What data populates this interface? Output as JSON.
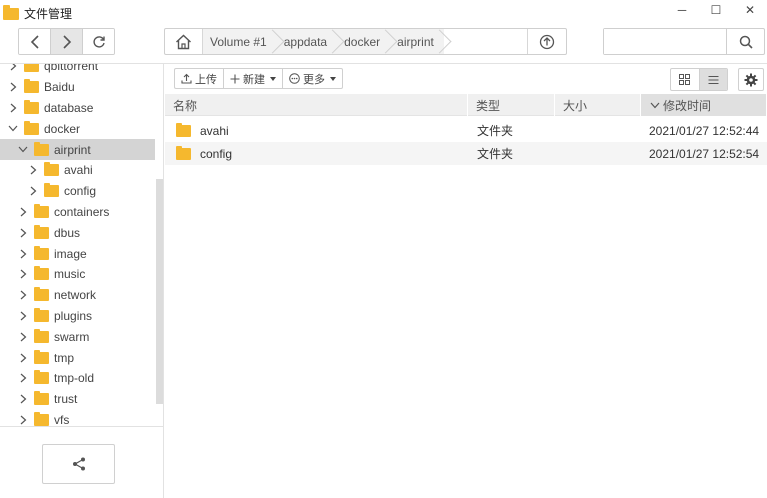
{
  "window": {
    "title": "文件管理",
    "controls": {
      "minimize": "─",
      "maximize": "☐",
      "close": "✕"
    }
  },
  "nav": {
    "path": [
      "Volume #1",
      "appdata",
      "docker",
      "airprint"
    ],
    "search_placeholder": ""
  },
  "sidebar": {
    "items": [
      {
        "label": "qbittorrent",
        "indent": 0,
        "expanded": false,
        "selected": false
      },
      {
        "label": "Baidu",
        "indent": 0,
        "expanded": false,
        "selected": false
      },
      {
        "label": "database",
        "indent": 0,
        "expanded": false,
        "selected": false
      },
      {
        "label": "docker",
        "indent": 0,
        "expanded": true,
        "selected": false
      },
      {
        "label": "airprint",
        "indent": 1,
        "expanded": true,
        "selected": true
      },
      {
        "label": "avahi",
        "indent": 2,
        "expanded": false,
        "selected": false
      },
      {
        "label": "config",
        "indent": 2,
        "expanded": false,
        "selected": false
      },
      {
        "label": "containers",
        "indent": 1,
        "expanded": false,
        "selected": false
      },
      {
        "label": "dbus",
        "indent": 1,
        "expanded": false,
        "selected": false
      },
      {
        "label": "image",
        "indent": 1,
        "expanded": false,
        "selected": false
      },
      {
        "label": "music",
        "indent": 1,
        "expanded": false,
        "selected": false
      },
      {
        "label": "network",
        "indent": 1,
        "expanded": false,
        "selected": false
      },
      {
        "label": "plugins",
        "indent": 1,
        "expanded": false,
        "selected": false
      },
      {
        "label": "swarm",
        "indent": 1,
        "expanded": false,
        "selected": false
      },
      {
        "label": "tmp",
        "indent": 1,
        "expanded": false,
        "selected": false
      },
      {
        "label": "tmp-old",
        "indent": 1,
        "expanded": false,
        "selected": false
      },
      {
        "label": "trust",
        "indent": 1,
        "expanded": false,
        "selected": false
      },
      {
        "label": "vfs",
        "indent": 1,
        "expanded": false,
        "selected": false
      }
    ]
  },
  "toolbar": {
    "upload_label": "上传",
    "new_label": "新建",
    "more_label": "更多"
  },
  "table": {
    "headers": {
      "name": "名称",
      "type": "类型",
      "size": "大小",
      "modified": "修改时间"
    },
    "sort_column": "modified",
    "rows": [
      {
        "name": "avahi",
        "type": "文件夹",
        "size": "",
        "modified": "2021/01/27 12:52:44"
      },
      {
        "name": "config",
        "type": "文件夹",
        "size": "",
        "modified": "2021/01/27 12:52:54"
      }
    ]
  },
  "colors": {
    "folder": "#f5b82e",
    "selected_row": "#d4d4d4",
    "header_bg": "#f0f0f0"
  }
}
